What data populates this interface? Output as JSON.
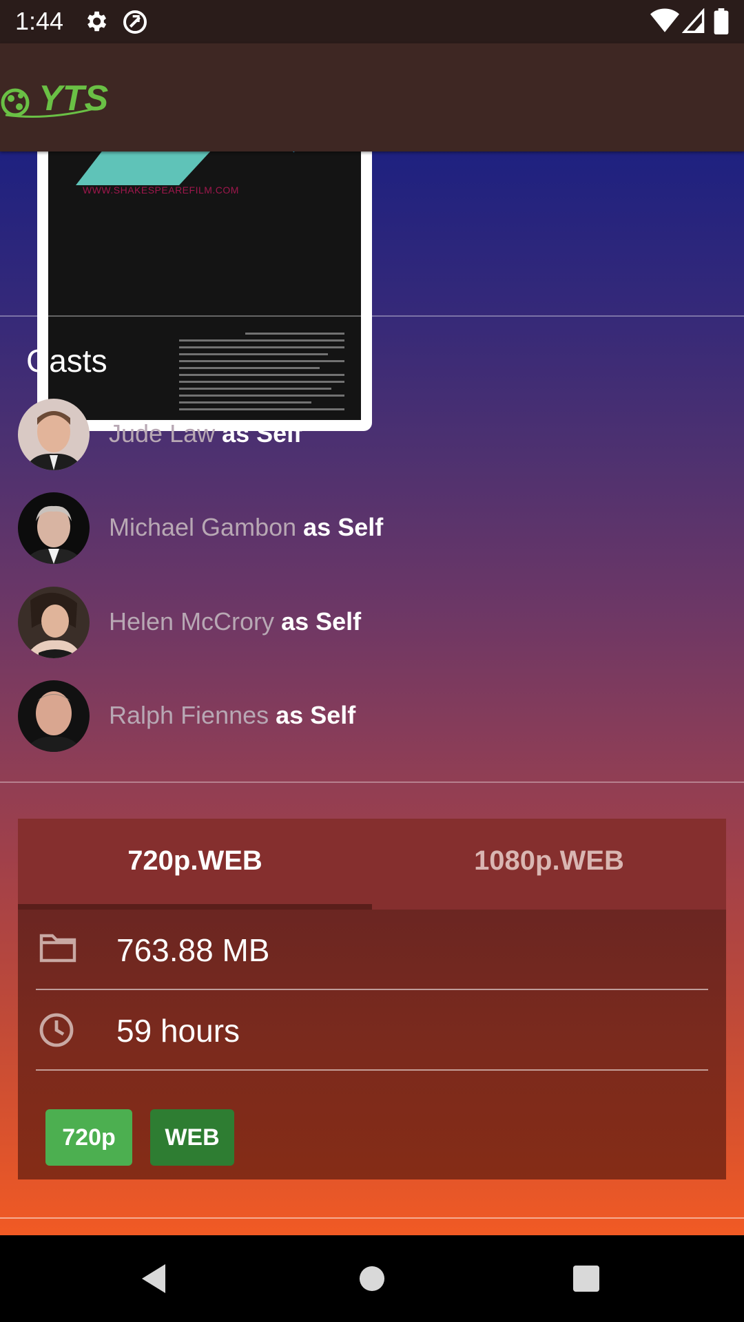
{
  "status_bar": {
    "time": "1:44",
    "icons": [
      "settings-icon",
      "do-not-disturb-icon",
      "wifi-icon",
      "cell-signal-icon",
      "battery-icon"
    ]
  },
  "app_bar": {
    "logo_text": "YTS",
    "logo_color": "#6ac045",
    "background": "#3e2723"
  },
  "poster": {
    "url_text": "WWW.SHAKESPEAREFILM.COM"
  },
  "casts": {
    "title": "Casts",
    "items": [
      {
        "name": "Jude Law",
        "role": "as Self"
      },
      {
        "name": "Michael Gambon",
        "role": "as Self"
      },
      {
        "name": "Helen McCrory",
        "role": "as Self"
      },
      {
        "name": "Ralph Fiennes",
        "role": "as Self"
      }
    ]
  },
  "torrents": {
    "tabs": [
      {
        "label": "720p.WEB",
        "selected": true
      },
      {
        "label": "1080p.WEB",
        "selected": false
      }
    ],
    "size": "763.88 MB",
    "runtime": "59 hours",
    "badges": [
      {
        "label": "720p",
        "color": "#4caf50"
      },
      {
        "label": "WEB",
        "color": "#2e7d32"
      }
    ]
  },
  "nav_bar": {
    "buttons": [
      "back-icon",
      "home-icon",
      "recents-icon"
    ]
  }
}
